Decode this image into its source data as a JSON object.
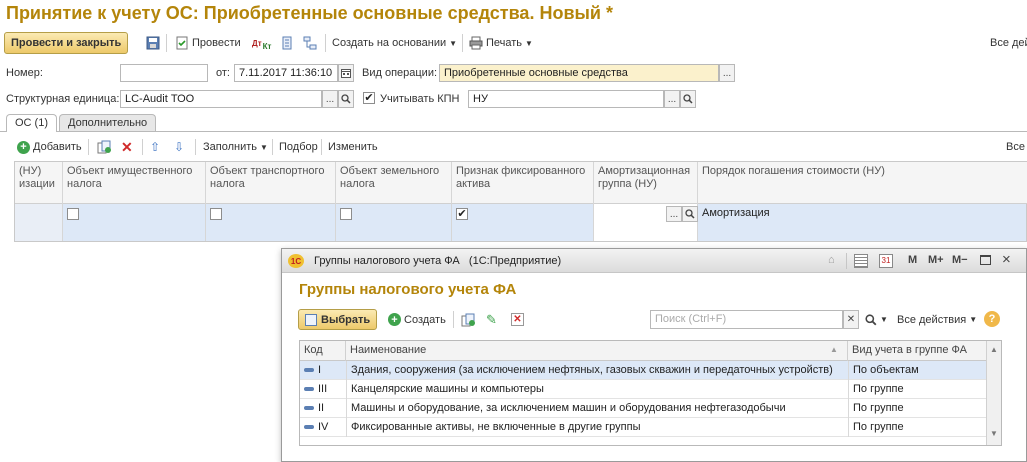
{
  "window": {
    "title": "Принятие к учету ОС: Приобретенные основные средства. Новый *"
  },
  "toolbar": {
    "post_close": "Провести и закрыть",
    "post": "Провести",
    "create_based": "Создать на основании",
    "print": "Печать",
    "all_actions": "Все дей"
  },
  "form": {
    "number_label": "Номер:",
    "number_value": "",
    "from_label": "от:",
    "date_value": "7.11.2017 11:36:10",
    "operation_label": "Вид операции:",
    "operation_value": "Приобретенные основные средства",
    "unit_label": "Структурная единица:",
    "unit_value": "LC-Audit ТОО",
    "kpn_label": "Учитывать КПН",
    "kpn_checked": true,
    "kpn_value": "НУ"
  },
  "tabs": [
    {
      "label": "ОС (1)",
      "active": true
    },
    {
      "label": "Дополнительно",
      "active": false
    }
  ],
  "grid_toolbar": {
    "add": "Добавить",
    "fill": "Заполнить",
    "select": "Подбор",
    "change": "Изменить",
    "all": "Все"
  },
  "grid": {
    "columns": [
      {
        "label": "(НУ)\nизации"
      },
      {
        "label": "Объект имущественного налога"
      },
      {
        "label": "Объект транспортного налога"
      },
      {
        "label": "Объект земельного налога"
      },
      {
        "label": "Признак фиксированного актива"
      },
      {
        "label": "Амортизационная группа (НУ)"
      },
      {
        "label": "Порядок погашения стоимости (НУ)"
      }
    ],
    "row": {
      "property_tax": false,
      "transport_tax": false,
      "land_tax": false,
      "fixed_asset": true,
      "amort_group": "",
      "repayment": "Амортизация"
    }
  },
  "popup": {
    "window_title": "Группы налогового учета ФА   (1С:Предприятие)",
    "heading": "Группы налогового учета ФА",
    "toolbar": {
      "choose": "Выбрать",
      "create": "Создать",
      "search_placeholder": "Поиск (Ctrl+F)",
      "all_actions": "Все действия",
      "help": "?"
    },
    "title_icons": [
      "M",
      "M+",
      "M−"
    ],
    "columns": [
      "Код",
      "Наименование",
      "Вид учета в группе ФА"
    ],
    "rows": [
      {
        "code": "I",
        "name": "Здания, сооружения (за исключением нефтяных, газовых скважин и передаточных устройств)",
        "type": "По объектам",
        "selected": true
      },
      {
        "code": "III",
        "name": "Канцелярские машины и компьютеры",
        "type": "По группе",
        "selected": false
      },
      {
        "code": "II",
        "name": "Машины и оборудование, за исключением машин и оборудования нефтегазодобычи",
        "type": "По группе",
        "selected": false
      },
      {
        "code": "IV",
        "name": "Фиксированные активы, не включенные в другие группы",
        "type": "По группе",
        "selected": false
      }
    ]
  },
  "colors": {
    "title": "#b4850a",
    "accent_button": "#edc96a",
    "selected_row": "#dde8f7",
    "field_yellow": "#fbf1cc"
  }
}
